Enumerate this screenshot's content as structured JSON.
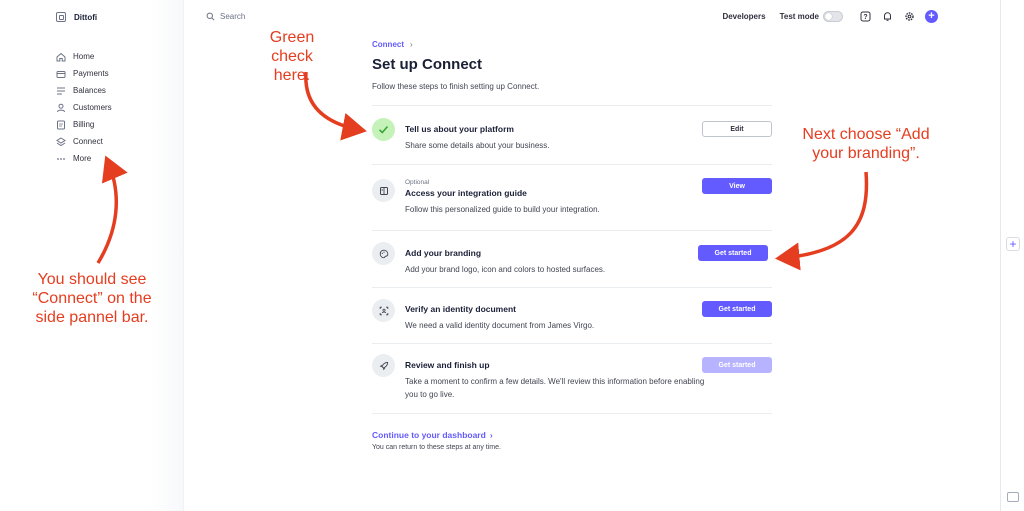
{
  "sidebar": {
    "account_name": "Dittofi",
    "items": [
      {
        "label": "Home",
        "icon": "home-icon"
      },
      {
        "label": "Payments",
        "icon": "wallet-icon"
      },
      {
        "label": "Balances",
        "icon": "balances-icon"
      },
      {
        "label": "Customers",
        "icon": "user-icon"
      },
      {
        "label": "Billing",
        "icon": "billing-icon"
      },
      {
        "label": "Connect",
        "icon": "layers-icon"
      },
      {
        "label": "More",
        "icon": "more-icon"
      }
    ]
  },
  "topbar": {
    "search_placeholder": "Search",
    "developers_label": "Developers",
    "test_mode_label": "Test mode",
    "test_mode_on": false
  },
  "main": {
    "breadcrumb": "Connect",
    "title": "Set up Connect",
    "subtitle": "Follow these steps to finish setting up Connect.",
    "steps": [
      {
        "optional": "",
        "title": "Tell us about your platform",
        "desc": "Share some details about your business.",
        "button": "Edit",
        "status": "done"
      },
      {
        "optional": "Optional",
        "title": "Access your integration guide",
        "desc": "Follow this personalized guide to build your integration.",
        "button": "View",
        "status": "active"
      },
      {
        "optional": "",
        "title": "Add your branding",
        "desc": "Add your brand logo, icon and colors to hosted surfaces.",
        "button": "Get started",
        "status": "active"
      },
      {
        "optional": "",
        "title": "Verify an identity document",
        "desc": "We need a valid identity document from James Virgo.",
        "button": "Get started",
        "status": "active"
      },
      {
        "optional": "",
        "title": "Review and finish up",
        "desc": "Take a moment to confirm a few details. We'll review this information before enabling you to go live.",
        "button": "Get started",
        "status": "disabled"
      }
    ],
    "continue_label": "Continue to your dashboard",
    "continue_sub": "You can return to these steps at any time."
  },
  "annotations": {
    "green_check": "Green check here.",
    "sidebar_note": "You should see “Connect” on the side pannel bar.",
    "branding_note": "Next choose “Add your branding”."
  },
  "colors": {
    "accent": "#635bff",
    "annotation": "#e53d1f",
    "done_badge": "#c5f2b9",
    "done_check": "#3aa33a"
  }
}
